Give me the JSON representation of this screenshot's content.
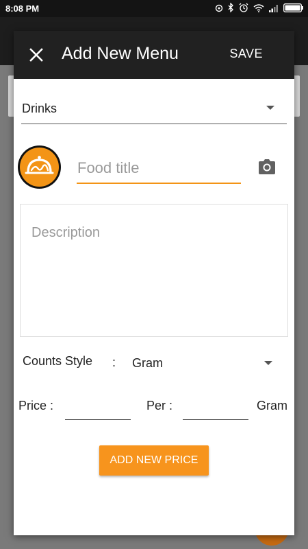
{
  "status_bar": {
    "time": "8:08 PM",
    "icons": [
      "data-saver-icon",
      "bluetooth-icon",
      "alarm-icon",
      "wifi-icon",
      "signal-icon",
      "battery-icon"
    ]
  },
  "dialog": {
    "title": "Add New Menu",
    "save_label": "SAVE",
    "close_icon": "close-icon",
    "category": {
      "selected": "Drinks"
    },
    "food_title": {
      "value": "",
      "placeholder": "Food title"
    },
    "camera_icon": "camera-icon",
    "description": {
      "value": "",
      "placeholder": "Description"
    },
    "counts_style": {
      "label": "Counts Style",
      "colon": ":",
      "selected": "Gram"
    },
    "price": {
      "label": "Price :",
      "value": ""
    },
    "per": {
      "label": "Per :",
      "value": ""
    },
    "unit": "Gram",
    "add_price_label": "ADD NEW PRICE"
  },
  "colors": {
    "accent": "#f7941d",
    "header": "#212121",
    "status_bar": "#141414"
  }
}
